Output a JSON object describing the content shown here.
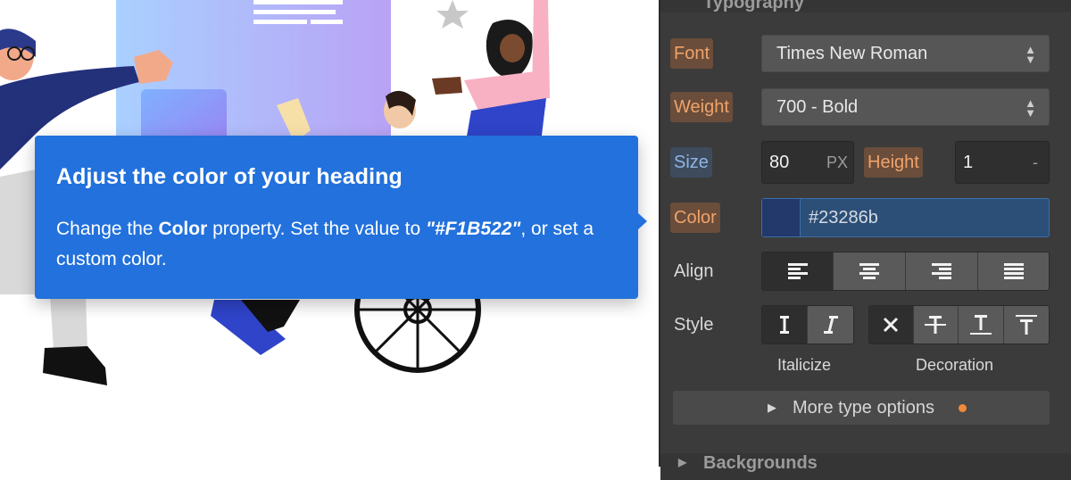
{
  "tooltip": {
    "title": "Adjust the color of your heading",
    "body_prefix": "Change the ",
    "body_bold": "Color",
    "body_mid": " property. Set the value to ",
    "body_value": "\"#F1B522\"",
    "body_suffix": ", or set a custom color."
  },
  "panel": {
    "top_section": "Typography",
    "bottom_section": "Backgrounds",
    "font": {
      "label": "Font",
      "value": "Times New Roman"
    },
    "weight": {
      "label": "Weight",
      "value": "700 - Bold"
    },
    "size": {
      "label": "Size",
      "value": "80",
      "unit": "PX"
    },
    "height": {
      "label": "Height",
      "value": "1",
      "unit": "-"
    },
    "color": {
      "label": "Color",
      "value": "#23286b",
      "swatch": "#23386b"
    },
    "align": {
      "label": "Align",
      "options": [
        "align-left-icon",
        "align-center-icon",
        "align-right-icon",
        "align-justify-icon"
      ],
      "selected": "align-left-icon"
    },
    "style": {
      "label": "Style",
      "italicize_caption": "Italicize",
      "decoration_caption": "Decoration",
      "italic_options": [
        "italic-off-icon",
        "italic-on-icon"
      ],
      "decoration_options": [
        "decoration-none-icon",
        "strikethrough-icon",
        "underline-icon",
        "overline-icon"
      ]
    },
    "more_options": "More type options"
  },
  "colors": {
    "tooltip_bg": "#2271dc",
    "panel_bg": "#3b3b3b",
    "accent_orange": "#f08a3c"
  }
}
